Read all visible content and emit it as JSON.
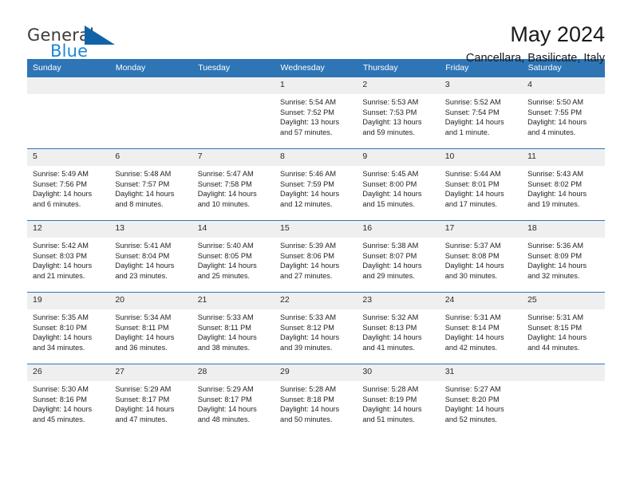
{
  "brand": {
    "name_top": "General",
    "name_bottom": "Blue",
    "accent_color": "#1c87d8",
    "logo_triangle_color": "#1063a8"
  },
  "header": {
    "title": "May 2024",
    "subtitle": "Cancellara, Basilicate, Italy",
    "header_bg": "#2e75b6",
    "daynum_bg": "#efefef"
  },
  "weekdays": [
    "Sunday",
    "Monday",
    "Tuesday",
    "Wednesday",
    "Thursday",
    "Friday",
    "Saturday"
  ],
  "weeks": [
    [
      {
        "empty": true,
        "day": ""
      },
      {
        "empty": true,
        "day": ""
      },
      {
        "empty": true,
        "day": ""
      },
      {
        "day": "1",
        "sunrise": "Sunrise: 5:54 AM",
        "sunset": "Sunset: 7:52 PM",
        "daylight1": "Daylight: 13 hours",
        "daylight2": "and 57 minutes."
      },
      {
        "day": "2",
        "sunrise": "Sunrise: 5:53 AM",
        "sunset": "Sunset: 7:53 PM",
        "daylight1": "Daylight: 13 hours",
        "daylight2": "and 59 minutes."
      },
      {
        "day": "3",
        "sunrise": "Sunrise: 5:52 AM",
        "sunset": "Sunset: 7:54 PM",
        "daylight1": "Daylight: 14 hours",
        "daylight2": "and 1 minute."
      },
      {
        "day": "4",
        "sunrise": "Sunrise: 5:50 AM",
        "sunset": "Sunset: 7:55 PM",
        "daylight1": "Daylight: 14 hours",
        "daylight2": "and 4 minutes."
      }
    ],
    [
      {
        "day": "5",
        "sunrise": "Sunrise: 5:49 AM",
        "sunset": "Sunset: 7:56 PM",
        "daylight1": "Daylight: 14 hours",
        "daylight2": "and 6 minutes."
      },
      {
        "day": "6",
        "sunrise": "Sunrise: 5:48 AM",
        "sunset": "Sunset: 7:57 PM",
        "daylight1": "Daylight: 14 hours",
        "daylight2": "and 8 minutes."
      },
      {
        "day": "7",
        "sunrise": "Sunrise: 5:47 AM",
        "sunset": "Sunset: 7:58 PM",
        "daylight1": "Daylight: 14 hours",
        "daylight2": "and 10 minutes."
      },
      {
        "day": "8",
        "sunrise": "Sunrise: 5:46 AM",
        "sunset": "Sunset: 7:59 PM",
        "daylight1": "Daylight: 14 hours",
        "daylight2": "and 12 minutes."
      },
      {
        "day": "9",
        "sunrise": "Sunrise: 5:45 AM",
        "sunset": "Sunset: 8:00 PM",
        "daylight1": "Daylight: 14 hours",
        "daylight2": "and 15 minutes."
      },
      {
        "day": "10",
        "sunrise": "Sunrise: 5:44 AM",
        "sunset": "Sunset: 8:01 PM",
        "daylight1": "Daylight: 14 hours",
        "daylight2": "and 17 minutes."
      },
      {
        "day": "11",
        "sunrise": "Sunrise: 5:43 AM",
        "sunset": "Sunset: 8:02 PM",
        "daylight1": "Daylight: 14 hours",
        "daylight2": "and 19 minutes."
      }
    ],
    [
      {
        "day": "12",
        "sunrise": "Sunrise: 5:42 AM",
        "sunset": "Sunset: 8:03 PM",
        "daylight1": "Daylight: 14 hours",
        "daylight2": "and 21 minutes."
      },
      {
        "day": "13",
        "sunrise": "Sunrise: 5:41 AM",
        "sunset": "Sunset: 8:04 PM",
        "daylight1": "Daylight: 14 hours",
        "daylight2": "and 23 minutes."
      },
      {
        "day": "14",
        "sunrise": "Sunrise: 5:40 AM",
        "sunset": "Sunset: 8:05 PM",
        "daylight1": "Daylight: 14 hours",
        "daylight2": "and 25 minutes."
      },
      {
        "day": "15",
        "sunrise": "Sunrise: 5:39 AM",
        "sunset": "Sunset: 8:06 PM",
        "daylight1": "Daylight: 14 hours",
        "daylight2": "and 27 minutes."
      },
      {
        "day": "16",
        "sunrise": "Sunrise: 5:38 AM",
        "sunset": "Sunset: 8:07 PM",
        "daylight1": "Daylight: 14 hours",
        "daylight2": "and 29 minutes."
      },
      {
        "day": "17",
        "sunrise": "Sunrise: 5:37 AM",
        "sunset": "Sunset: 8:08 PM",
        "daylight1": "Daylight: 14 hours",
        "daylight2": "and 30 minutes."
      },
      {
        "day": "18",
        "sunrise": "Sunrise: 5:36 AM",
        "sunset": "Sunset: 8:09 PM",
        "daylight1": "Daylight: 14 hours",
        "daylight2": "and 32 minutes."
      }
    ],
    [
      {
        "day": "19",
        "sunrise": "Sunrise: 5:35 AM",
        "sunset": "Sunset: 8:10 PM",
        "daylight1": "Daylight: 14 hours",
        "daylight2": "and 34 minutes."
      },
      {
        "day": "20",
        "sunrise": "Sunrise: 5:34 AM",
        "sunset": "Sunset: 8:11 PM",
        "daylight1": "Daylight: 14 hours",
        "daylight2": "and 36 minutes."
      },
      {
        "day": "21",
        "sunrise": "Sunrise: 5:33 AM",
        "sunset": "Sunset: 8:11 PM",
        "daylight1": "Daylight: 14 hours",
        "daylight2": "and 38 minutes."
      },
      {
        "day": "22",
        "sunrise": "Sunrise: 5:33 AM",
        "sunset": "Sunset: 8:12 PM",
        "daylight1": "Daylight: 14 hours",
        "daylight2": "and 39 minutes."
      },
      {
        "day": "23",
        "sunrise": "Sunrise: 5:32 AM",
        "sunset": "Sunset: 8:13 PM",
        "daylight1": "Daylight: 14 hours",
        "daylight2": "and 41 minutes."
      },
      {
        "day": "24",
        "sunrise": "Sunrise: 5:31 AM",
        "sunset": "Sunset: 8:14 PM",
        "daylight1": "Daylight: 14 hours",
        "daylight2": "and 42 minutes."
      },
      {
        "day": "25",
        "sunrise": "Sunrise: 5:31 AM",
        "sunset": "Sunset: 8:15 PM",
        "daylight1": "Daylight: 14 hours",
        "daylight2": "and 44 minutes."
      }
    ],
    [
      {
        "day": "26",
        "sunrise": "Sunrise: 5:30 AM",
        "sunset": "Sunset: 8:16 PM",
        "daylight1": "Daylight: 14 hours",
        "daylight2": "and 45 minutes."
      },
      {
        "day": "27",
        "sunrise": "Sunrise: 5:29 AM",
        "sunset": "Sunset: 8:17 PM",
        "daylight1": "Daylight: 14 hours",
        "daylight2": "and 47 minutes."
      },
      {
        "day": "28",
        "sunrise": "Sunrise: 5:29 AM",
        "sunset": "Sunset: 8:17 PM",
        "daylight1": "Daylight: 14 hours",
        "daylight2": "and 48 minutes."
      },
      {
        "day": "29",
        "sunrise": "Sunrise: 5:28 AM",
        "sunset": "Sunset: 8:18 PM",
        "daylight1": "Daylight: 14 hours",
        "daylight2": "and 50 minutes."
      },
      {
        "day": "30",
        "sunrise": "Sunrise: 5:28 AM",
        "sunset": "Sunset: 8:19 PM",
        "daylight1": "Daylight: 14 hours",
        "daylight2": "and 51 minutes."
      },
      {
        "day": "31",
        "sunrise": "Sunrise: 5:27 AM",
        "sunset": "Sunset: 8:20 PM",
        "daylight1": "Daylight: 14 hours",
        "daylight2": "and 52 minutes."
      },
      {
        "empty": true,
        "day": ""
      }
    ]
  ]
}
